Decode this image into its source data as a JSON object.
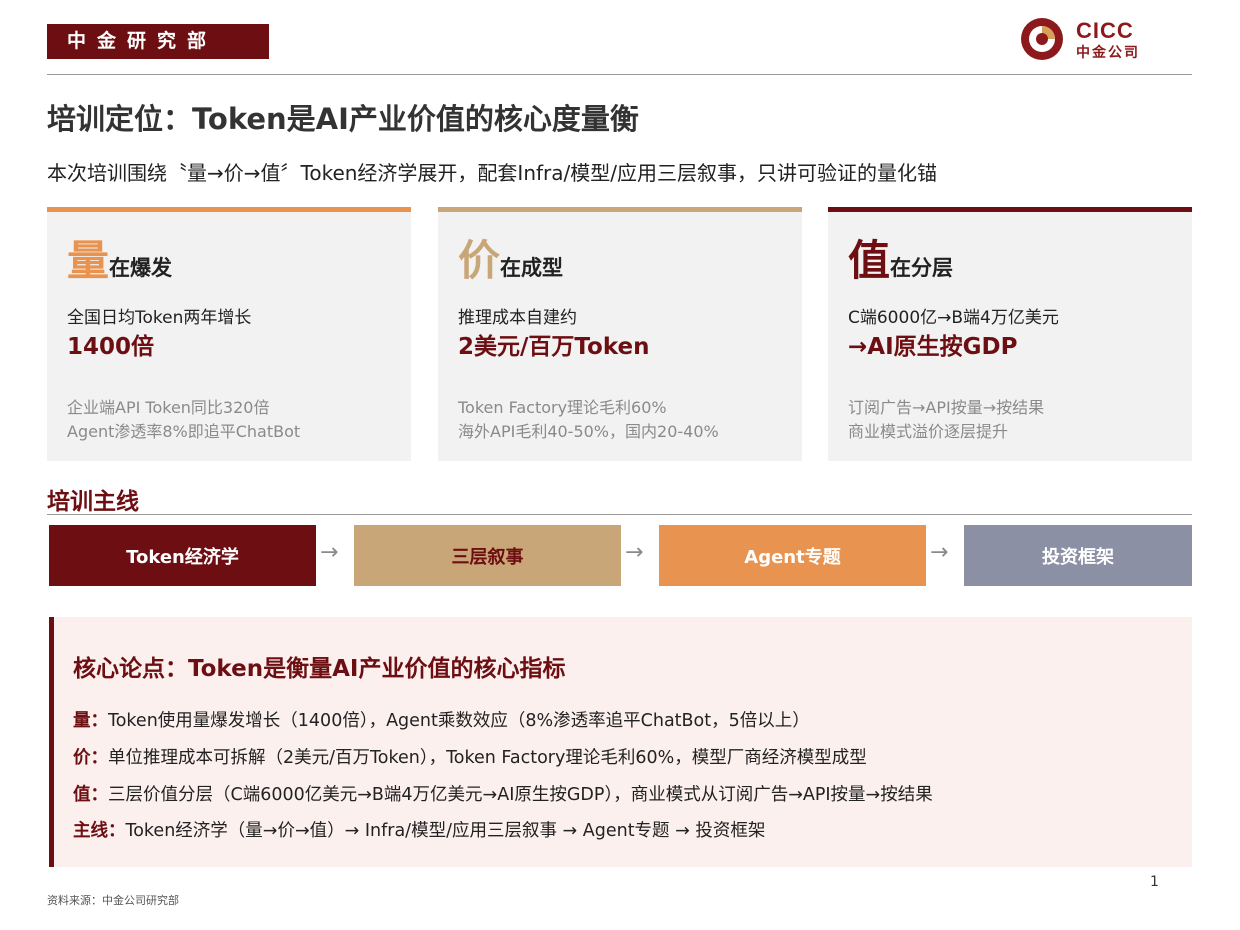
{
  "header": {
    "dept": "中金研究部",
    "logo_en": "CICC",
    "logo_cn": "中金公司"
  },
  "title": "培训定位：Token是AI产业价值的核心度量衡",
  "subtitle": "本次培训围绕〝量→价→值〞Token经济学展开，配套Infra/模型/应用三层叙事，只讲可验证的量化锚",
  "cards": [
    {
      "big": "量",
      "small": "在爆发",
      "desc": "全国日均Token两年增长",
      "highlight": "1400倍",
      "note1": "企业端API Token同比320倍",
      "note2": "Agent渗透率8%即追平ChatBot",
      "color": "#e8934f"
    },
    {
      "big": "价",
      "small": "在成型",
      "desc": "推理成本自建约",
      "highlight": "2美元/百万Token",
      "note1": "Token Factory理论毛利60%",
      "note2": "海外API毛利40-50%，国内20-40%",
      "color": "#c9a678"
    },
    {
      "big": "值",
      "small": "在分层",
      "desc": "C端6000亿→B端4万亿美元",
      "highlight": "→AI原生按GDP",
      "note1": "订阅广告→API按量→按结果",
      "note2": "商业模式溢价逐层提升",
      "color": "#6d0f12"
    }
  ],
  "mainline": {
    "title": "培训主线",
    "steps": [
      {
        "label": "Token经济学",
        "color": "#6d0f12",
        "text_color": "#ffffff"
      },
      {
        "label": "三层叙事",
        "color": "#c9a678",
        "text_color": "#6d0f12"
      },
      {
        "label": "Agent专题",
        "color": "#e8934f",
        "text_color": "#ffffff"
      },
      {
        "label": "投资框架",
        "color": "#8b90a5",
        "text_color": "#ffffff"
      }
    ],
    "arrow": "→"
  },
  "core": {
    "title": "核心论点：Token是衡量AI产业价值的核心指标",
    "rows": [
      {
        "key": "量：",
        "text": "Token使用量爆发增长（1400倍），Agent乘数效应（8%渗透率追平ChatBot，5倍以上）"
      },
      {
        "key": "价：",
        "text": "单位推理成本可拆解（2美元/百万Token），Token Factory理论毛利60%，模型厂商经济模型成型"
      },
      {
        "key": "值：",
        "text": "三层价值分层（C端6000亿美元→B端4万亿美元→AI原生按GDP），商业模式从订阅广告→API按量→按结果"
      },
      {
        "key": "主线：",
        "text": "Token经济学（量→价→值）→ Infra/模型/应用三层叙事 → Agent专题 → 投资框架"
      }
    ]
  },
  "footer": {
    "source": "资料来源：中金公司研究部",
    "page": "1"
  },
  "colors": {
    "brand": "#6d0f12",
    "orange": "#e8934f",
    "tan": "#c9a678",
    "slate": "#8b90a5"
  }
}
